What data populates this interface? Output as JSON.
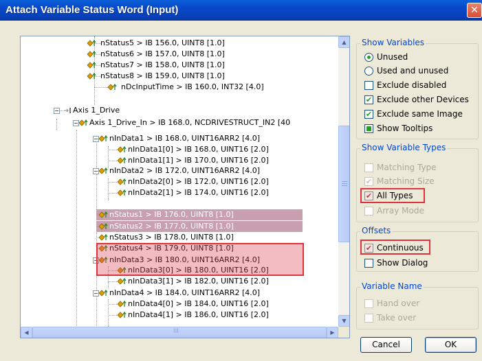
{
  "window": {
    "title": "Attach Variable Status Word (Input)"
  },
  "tree": {
    "rows": [
      {
        "text": "nStatus5  >  IB 156.0, UINT8 [1.0]"
      },
      {
        "text": "nStatus6  >  IB 157.0, UINT8 [1.0]"
      },
      {
        "text": "nStatus7  >  IB 158.0, UINT8 [1.0]"
      },
      {
        "text": "nStatus8  >  IB 159.0, UINT8 [1.0]"
      },
      {
        "text": "nDcInputTime  >  IB 160.0, INT32 [4.0]"
      },
      {
        "text": "Axis 1_Drive"
      },
      {
        "text": "Axis 1_Drive_In  >  IB 168.0, NCDRIVESTRUCT_IN2 [40"
      },
      {
        "text": "nInData1  >  IB 168.0, UINT16ARR2 [4.0]"
      },
      {
        "text": "nInData1[0]  >  IB 168.0, UINT16 [2.0]"
      },
      {
        "text": "nInData1[1]  >  IB 170.0, UINT16 [2.0]"
      },
      {
        "text": "nInData2  >  IB 172.0, UINT16ARR2 [4.0]"
      },
      {
        "text": "nInData2[0]  >  IB 172.0, UINT16 [2.0]"
      },
      {
        "text": "nInData2[1]  >  IB 174.0, UINT16 [2.0]"
      },
      {
        "text": "nStatus1  >  IB 176.0, UINT8 [1.0]"
      },
      {
        "text": "nStatus2  >  IB 177.0, UINT8 [1.0]"
      },
      {
        "text": "nStatus3  >  IB 178.0, UINT8 [1.0]"
      },
      {
        "text": "nStatus4  >  IB 179.0, UINT8 [1.0]"
      },
      {
        "text": "nInData3  >  IB 180.0, UINT16ARR2 [4.0]"
      },
      {
        "text": "nInData3[0]  >  IB 180.0, UINT16 [2.0]"
      },
      {
        "text": "nInData3[1]  >  IB 182.0, UINT16 [2.0]"
      },
      {
        "text": "nInData4  >  IB 184.0, UINT16ARR2 [4.0]"
      },
      {
        "text": "nInData4[0]  >  IB 184.0, UINT16 [2.0]"
      },
      {
        "text": "nInData4[1]  >  IB 186.0, UINT16 [2.0]"
      }
    ],
    "scrollbar_grip": "III"
  },
  "show_variables": {
    "title": "Show Variables",
    "unused": "Unused",
    "used_and_unused": "Used and unused",
    "exclude_disabled": "Exclude disabled",
    "exclude_other_devices": "Exclude other Devices",
    "exclude_same_image": "Exclude same Image",
    "show_tooltips": "Show Tooltips"
  },
  "show_variable_types": {
    "title": "Show Variable Types",
    "matching_type": "Matching Type",
    "matching_size": "Matching Size",
    "all_types": "All Types",
    "array_mode": "Array Mode"
  },
  "offsets": {
    "title": "Offsets",
    "continuous": "Continuous",
    "show_dialog": "Show Dialog"
  },
  "variable_name": {
    "title": "Variable Name",
    "hand_over": "Hand over",
    "take_over": "Take over"
  },
  "buttons": {
    "cancel": "Cancel",
    "ok": "OK"
  },
  "colors": {
    "title_bar": "#0848c8",
    "highlight": "#e0303a",
    "check_green": "#21a121"
  }
}
